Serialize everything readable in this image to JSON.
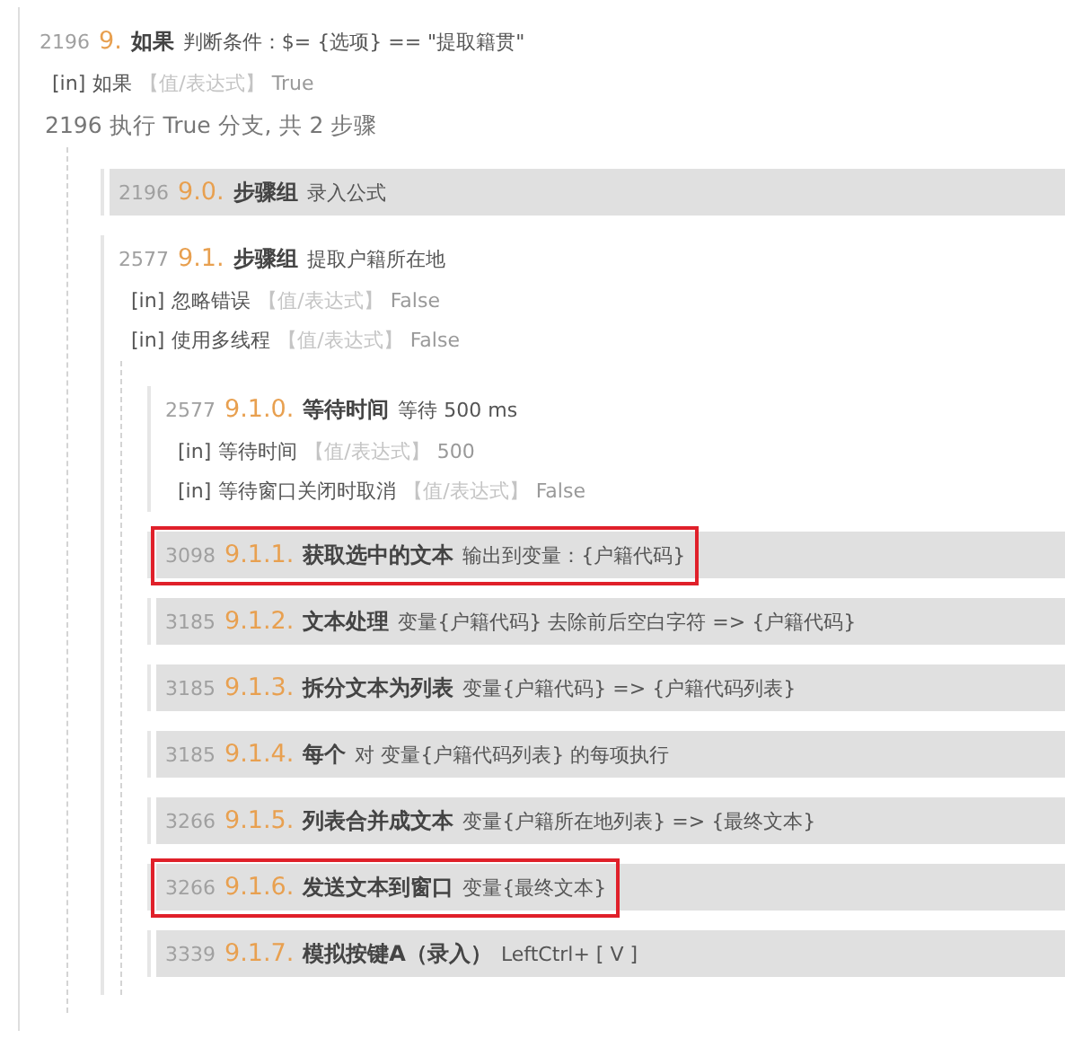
{
  "root": {
    "line": "2196",
    "number": "9.",
    "title": "如果",
    "desc": "判断条件：$= {选项} == \"提取籍贯\"",
    "params": [
      {
        "tag": "[in]",
        "name": "如果",
        "type": "【值/表达式】",
        "value": "True"
      }
    ],
    "branch": {
      "line": "2196",
      "text": "执行 True 分支, 共 2 步骤"
    },
    "children": [
      {
        "line": "2196",
        "number": "9.0.",
        "title": "步骤组",
        "desc": "录入公式",
        "highlighted": true,
        "outlined": false
      },
      {
        "line": "2577",
        "number": "9.1.",
        "title": "步骤组",
        "desc": "提取户籍所在地",
        "highlighted": false,
        "outlined": false,
        "params": [
          {
            "tag": "[in]",
            "name": "忽略错误",
            "type": "【值/表达式】",
            "value": "False"
          },
          {
            "tag": "[in]",
            "name": "使用多线程",
            "type": "【值/表达式】",
            "value": "False"
          }
        ],
        "children": [
          {
            "line": "2577",
            "number": "9.1.0.",
            "title": "等待时间",
            "desc": "等待 500 ms",
            "highlighted": false,
            "outlined": false,
            "params": [
              {
                "tag": "[in]",
                "name": "等待时间",
                "type": "【值/表达式】",
                "value": "500"
              },
              {
                "tag": "[in]",
                "name": "等待窗口关闭时取消",
                "type": "【值/表达式】",
                "value": "False"
              }
            ]
          },
          {
            "line": "3098",
            "number": "9.1.1.",
            "title": "获取选中的文本",
            "desc": "输出到变量：{户籍代码}",
            "highlighted": true,
            "outlined": true
          },
          {
            "line": "3185",
            "number": "9.1.2.",
            "title": "文本处理",
            "desc": "变量{户籍代码} 去除前后空白字符 => {户籍代码}",
            "highlighted": true,
            "outlined": false
          },
          {
            "line": "3185",
            "number": "9.1.3.",
            "title": "拆分文本为列表",
            "desc": "变量{户籍代码} => {户籍代码列表}",
            "highlighted": true,
            "outlined": false
          },
          {
            "line": "3185",
            "number": "9.1.4.",
            "title": "每个",
            "desc": "对 变量{户籍代码列表} 的每项执行",
            "highlighted": true,
            "outlined": false
          },
          {
            "line": "3266",
            "number": "9.1.5.",
            "title": "列表合并成文本",
            "desc": "变量{户籍所在地列表} => {最终文本}",
            "highlighted": true,
            "outlined": false
          },
          {
            "line": "3266",
            "number": "9.1.6.",
            "title": "发送文本到窗口",
            "desc": "变量{最终文本}",
            "highlighted": true,
            "outlined": true
          },
          {
            "line": "3339",
            "number": "9.1.7.",
            "title": "模拟按键A（录入）",
            "desc": "LeftCtrl+ [ V ]",
            "highlighted": true,
            "outlined": false
          }
        ]
      }
    ]
  }
}
